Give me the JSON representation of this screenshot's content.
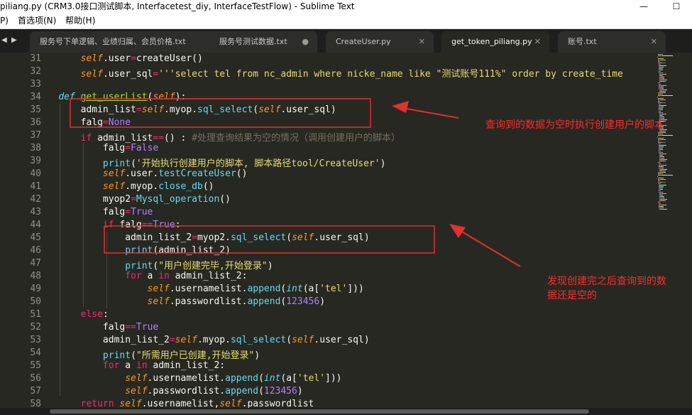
{
  "window": {
    "title": "piliang.py (CRM3.0接口测试脚本, Interfacetest_diy, InterfaceTestFlow) - Sublime Text",
    "minimize_label": "—",
    "maximize_label": "☐"
  },
  "menu": [
    {
      "label": "P)"
    },
    {
      "label": "首选项(N)"
    },
    {
      "label": "帮助(H)"
    }
  ],
  "tabbar": {
    "nav_left": "◀",
    "nav_right": "▶"
  },
  "tabs": [
    {
      "label": "服务号下单逻辑、业绩归属、会员价格.txt",
      "mark": "●"
    },
    {
      "label": "服务号测试数据.txt",
      "mark": "●"
    },
    {
      "label": "CreateUser.py",
      "mark": "✕"
    },
    {
      "label": "get_token_piliang.py",
      "mark": "✕"
    },
    {
      "label": "账号.txt",
      "mark": "✕"
    }
  ],
  "line_numbers": [
    "31",
    "32",
    "33",
    "34",
    "35",
    "36",
    "37",
    "38",
    "39",
    "40",
    "41",
    "42",
    "43",
    "44",
    "45",
    "46",
    "47",
    "48",
    "49",
    "50",
    "51",
    "52",
    "53",
    "54",
    "55",
    "56",
    "57",
    "58"
  ],
  "code": [
    [
      {
        "t": "        "
      },
      {
        "t": "self",
        "c": "self"
      },
      {
        "t": "."
      },
      {
        "t": "user"
      },
      {
        "t": "=",
        "c": "kw"
      },
      {
        "t": "createUser()"
      }
    ],
    [
      {
        "t": "        "
      },
      {
        "t": "self",
        "c": "self"
      },
      {
        "t": ".user_sql"
      },
      {
        "t": "=",
        "c": "kw"
      },
      {
        "t": "'''select tel from nc_admin where nicke_name like \"测试账号111%\" order by create_time",
        "c": "str"
      }
    ],
    [
      {
        "t": ""
      }
    ],
    [
      {
        "t": "    "
      },
      {
        "t": "def",
        "c": "def"
      },
      {
        "t": " "
      },
      {
        "t": "get_userList",
        "c": "fdef"
      },
      {
        "t": "("
      },
      {
        "t": "self",
        "c": "self"
      },
      {
        "t": "):"
      }
    ],
    [
      {
        "t": "        admin_list"
      },
      {
        "t": "=",
        "c": "kw"
      },
      {
        "t": "self",
        "c": "self"
      },
      {
        "t": ".myop."
      },
      {
        "t": "sql_select",
        "c": "fn"
      },
      {
        "t": "("
      },
      {
        "t": "self",
        "c": "self"
      },
      {
        "t": ".user_sql)"
      }
    ],
    [
      {
        "t": "        falg"
      },
      {
        "t": "=",
        "c": "kw"
      },
      {
        "t": "None",
        "c": "num"
      }
    ],
    [
      {
        "t": "        "
      },
      {
        "t": "if",
        "c": "kw"
      },
      {
        "t": " admin_list"
      },
      {
        "t": "==",
        "c": "kw"
      },
      {
        "t": "() : "
      },
      {
        "t": "#处理查询结果为空的情况（调用创建用户的脚本）",
        "c": "cm"
      }
    ],
    [
      {
        "t": "            falg"
      },
      {
        "t": "=",
        "c": "kw"
      },
      {
        "t": "False",
        "c": "num"
      }
    ],
    [
      {
        "t": "            "
      },
      {
        "t": "print",
        "c": "fn"
      },
      {
        "t": "("
      },
      {
        "t": "'开始执行创建用户的脚本, 脚本路径tool/CreateUser'",
        "c": "str"
      },
      {
        "t": ")"
      }
    ],
    [
      {
        "t": "            "
      },
      {
        "t": "self",
        "c": "self"
      },
      {
        "t": ".user."
      },
      {
        "t": "testCreateUser",
        "c": "fn"
      },
      {
        "t": "()"
      }
    ],
    [
      {
        "t": "            "
      },
      {
        "t": "self",
        "c": "self"
      },
      {
        "t": ".myop."
      },
      {
        "t": "close_db",
        "c": "fn"
      },
      {
        "t": "()"
      }
    ],
    [
      {
        "t": "            myop2"
      },
      {
        "t": "=",
        "c": "kw"
      },
      {
        "t": "Mysql_operation",
        "c": "fn"
      },
      {
        "t": "()"
      }
    ],
    [
      {
        "t": "            falg"
      },
      {
        "t": "=",
        "c": "kw"
      },
      {
        "t": "True",
        "c": "num"
      }
    ],
    [
      {
        "t": "            "
      },
      {
        "t": "if",
        "c": "kw"
      },
      {
        "t": " falg"
      },
      {
        "t": "==",
        "c": "kw"
      },
      {
        "t": "True",
        "c": "num"
      },
      {
        "t": ":"
      }
    ],
    [
      {
        "t": "                admin_list_2"
      },
      {
        "t": "=",
        "c": "kw"
      },
      {
        "t": "myop2."
      },
      {
        "t": "sql_select",
        "c": "fn"
      },
      {
        "t": "("
      },
      {
        "t": "self",
        "c": "self"
      },
      {
        "t": ".user_sql)"
      }
    ],
    [
      {
        "t": "                "
      },
      {
        "t": "print",
        "c": "fn"
      },
      {
        "t": "(admin_list_2)"
      }
    ],
    [
      {
        "t": "                "
      },
      {
        "t": "print",
        "c": "fn"
      },
      {
        "t": "("
      },
      {
        "t": "\"用户创建完毕,开始登录\"",
        "c": "str"
      },
      {
        "t": ")"
      }
    ],
    [
      {
        "t": "                "
      },
      {
        "t": "for",
        "c": "kw"
      },
      {
        "t": " a "
      },
      {
        "t": "in",
        "c": "kw"
      },
      {
        "t": " admin_list_2:"
      }
    ],
    [
      {
        "t": "                    "
      },
      {
        "t": "self",
        "c": "self"
      },
      {
        "t": ".usernamelist."
      },
      {
        "t": "append",
        "c": "fn"
      },
      {
        "t": "("
      },
      {
        "t": "int",
        "c": "cls"
      },
      {
        "t": "(a["
      },
      {
        "t": "'tel'",
        "c": "str"
      },
      {
        "t": "]))"
      }
    ],
    [
      {
        "t": "                    "
      },
      {
        "t": "self",
        "c": "self"
      },
      {
        "t": ".passwordlist."
      },
      {
        "t": "append",
        "c": "fn"
      },
      {
        "t": "("
      },
      {
        "t": "123456",
        "c": "num"
      },
      {
        "t": ")"
      }
    ],
    [
      {
        "t": "        "
      },
      {
        "t": "else",
        "c": "kw"
      },
      {
        "t": ":"
      }
    ],
    [
      {
        "t": "            falg"
      },
      {
        "t": "==",
        "c": "kw"
      },
      {
        "t": "True",
        "c": "num"
      }
    ],
    [
      {
        "t": "            admin_list_2"
      },
      {
        "t": "=",
        "c": "kw"
      },
      {
        "t": "self",
        "c": "self"
      },
      {
        "t": ".myop."
      },
      {
        "t": "sql_select",
        "c": "fn"
      },
      {
        "t": "("
      },
      {
        "t": "self",
        "c": "self"
      },
      {
        "t": ".user_sql)"
      }
    ],
    [
      {
        "t": "            "
      },
      {
        "t": "print",
        "c": "fn"
      },
      {
        "t": "("
      },
      {
        "t": "\"所需用户已创建,开始登录\"",
        "c": "str"
      },
      {
        "t": ")"
      }
    ],
    [
      {
        "t": "            "
      },
      {
        "t": "for",
        "c": "kw"
      },
      {
        "t": " a "
      },
      {
        "t": "in",
        "c": "kw"
      },
      {
        "t": " admin_list_2:"
      }
    ],
    [
      {
        "t": "                "
      },
      {
        "t": "self",
        "c": "self"
      },
      {
        "t": ".usernamelist."
      },
      {
        "t": "append",
        "c": "fn"
      },
      {
        "t": "("
      },
      {
        "t": "int",
        "c": "cls"
      },
      {
        "t": "(a["
      },
      {
        "t": "'tel'",
        "c": "str"
      },
      {
        "t": "]))"
      }
    ],
    [
      {
        "t": "                "
      },
      {
        "t": "self",
        "c": "self"
      },
      {
        "t": ".passwordlist."
      },
      {
        "t": "append",
        "c": "fn"
      },
      {
        "t": "("
      },
      {
        "t": "123456",
        "c": "num"
      },
      {
        "t": ")"
      }
    ],
    [
      {
        "t": "        "
      },
      {
        "t": "return",
        "c": "kw"
      },
      {
        "t": " "
      },
      {
        "t": "self",
        "c": "self"
      },
      {
        "t": ".usernamelist,"
      },
      {
        "t": "self",
        "c": "self"
      },
      {
        "t": ".passwordlist"
      }
    ]
  ],
  "annotations": {
    "note_1": "查询到的数据为空时执行创建用户的脚本",
    "note_2": "发现创建完之后查询到的数\n据还是空的",
    "color": "#ff2a2a"
  },
  "colors": {
    "background": "#272822",
    "keyword": "#f92672",
    "self": "#fd971f",
    "builtin": "#66d9ef",
    "string": "#e6db74",
    "number": "#ae81ff",
    "comment": "#75715e",
    "function_def": "#a6e22e"
  }
}
